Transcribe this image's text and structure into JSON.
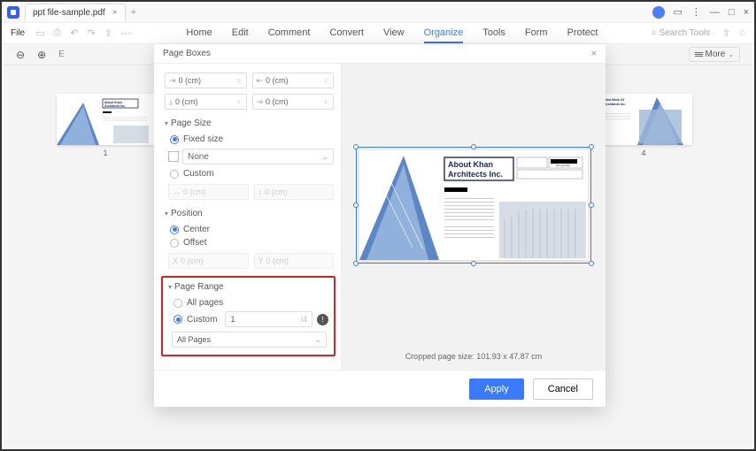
{
  "app": {
    "tab_title": "ppt file-sample.pdf"
  },
  "menubar": {
    "file_label": "File",
    "items": [
      "Home",
      "Edit",
      "Comment",
      "Convert",
      "View",
      "Organize",
      "Tools",
      "Form",
      "Protect"
    ],
    "active_index": 5,
    "search_placeholder": "Search Tools"
  },
  "toolbar": {
    "more_label": "More"
  },
  "thumbs": {
    "l1": "1",
    "l4": "4"
  },
  "dialog": {
    "title": "Page Boxes",
    "margins": {
      "top": "0 (cm)",
      "bottom": "0 (cm)",
      "left": "0 (cm)",
      "right": "0 (cm)"
    },
    "page_size": {
      "title": "Page Size",
      "fixed_label": "Fixed size",
      "none_label": "None",
      "custom_label": "Custom",
      "w_placeholder": "0 (cm)",
      "h_placeholder": "0 (cm)"
    },
    "position": {
      "title": "Position",
      "center_label": "Center",
      "offset_label": "Offset",
      "x_prefix": "X",
      "y_prefix": "Y",
      "x_placeholder": "0 (cm)",
      "y_placeholder": "0 (cm)"
    },
    "page_range": {
      "title": "Page Range",
      "all_label": "All pages",
      "custom_label": "Custom",
      "custom_value": "1",
      "total_suffix": "/4",
      "subset_label": "All Pages"
    },
    "crop_info": "Cropped page size: 101.93 x 47.87 cm",
    "apply_label": "Apply",
    "cancel_label": "Cancel"
  },
  "preview_text": {
    "l1": "About Khan",
    "l2": "Architects Inc.",
    "rv": "REVIEWED"
  },
  "thumb_right_text": {
    "l1": "he New Work Of",
    "l2": "an Architects Inc."
  }
}
